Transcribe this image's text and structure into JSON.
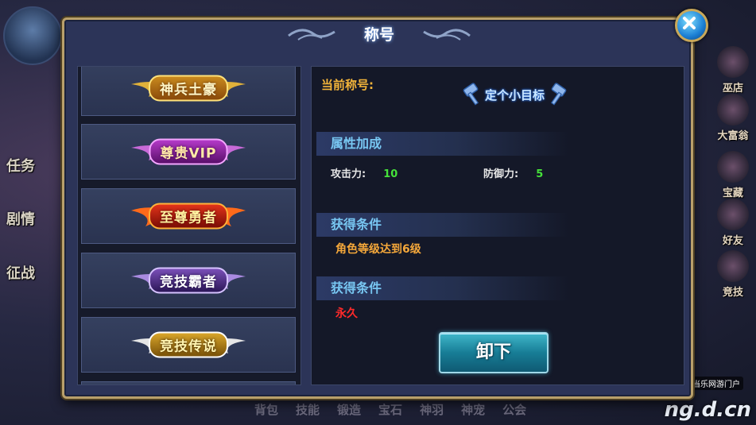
{
  "dialog": {
    "title": "称号",
    "close_icon": "close-x-icon"
  },
  "title_list": [
    {
      "label": "神兵土豪",
      "style": "gold"
    },
    {
      "label": "尊贵VIP",
      "style": "purple"
    },
    {
      "label": "至尊勇者",
      "style": "fire"
    },
    {
      "label": "竞技霸者",
      "style": "violet"
    },
    {
      "label": "竞技传说",
      "style": "silver-gold"
    }
  ],
  "detail": {
    "current_label": "当前称号:",
    "current_title": "定个小目标",
    "current_title_icon": "hammer-icon",
    "attr_header": "属性加成",
    "attack_label": "攻击力:",
    "attack_value": "10",
    "defense_label": "防御力:",
    "defense_value": "5",
    "cond_header_1": "获得条件",
    "cond_text_1": "角色等级达到6级",
    "cond_header_2": "获得条件",
    "cond_text_2": "永久",
    "unequip_label": "卸下"
  },
  "colors": {
    "accent_gold": "#b9a06b",
    "label_orange": "#f4b53a",
    "section_blue": "#78c7f2",
    "value_green": "#45e23a",
    "permanent_red": "#ff2a2a",
    "button_teal": "#177d96"
  },
  "background": {
    "left_items": [
      "任务",
      "剧情",
      "征战"
    ],
    "right_items": [
      "巫店",
      "大富翁",
      "宝藏",
      "好友",
      "竞技"
    ],
    "bottom_menu": [
      "背包",
      "技能",
      "锻造",
      "宝石",
      "神羽",
      "神宠",
      "公会"
    ],
    "watermark": "ng.d.cn",
    "watermark_tag": "当乐网游门户"
  }
}
